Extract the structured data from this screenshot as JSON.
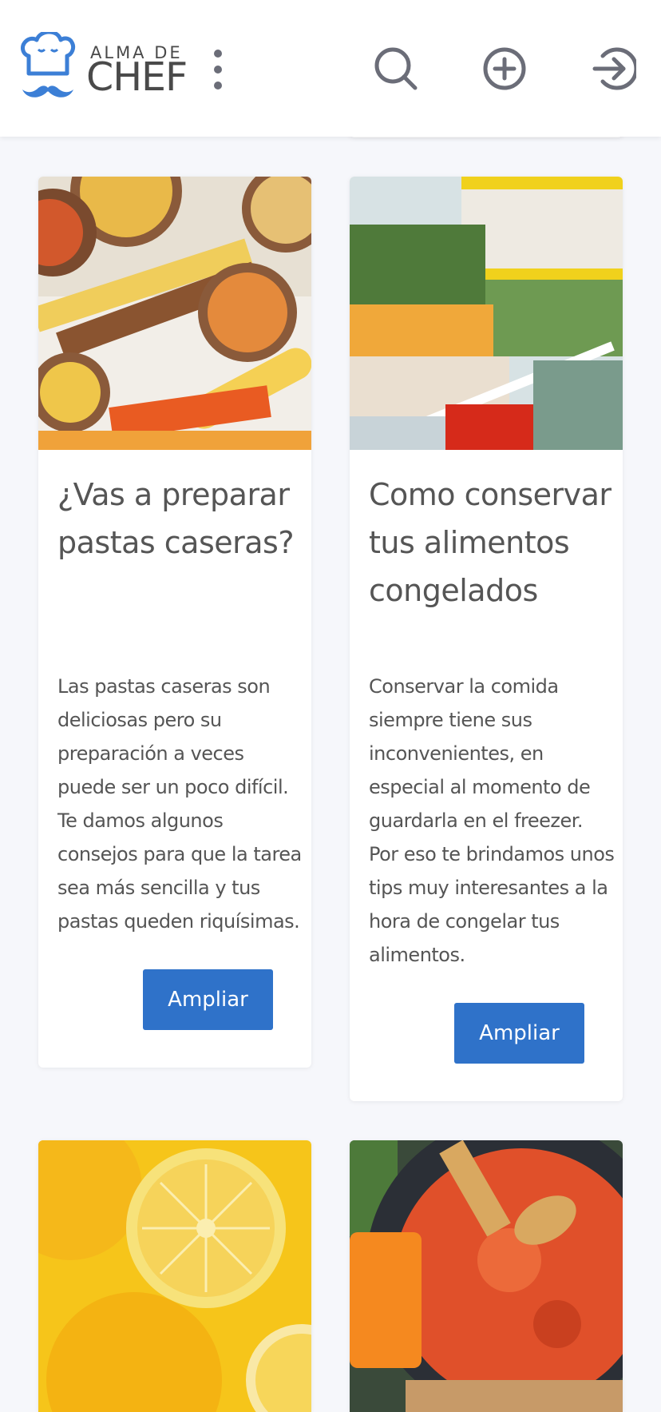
{
  "header": {
    "logo_small": "ALMA DE",
    "logo_big": "CHEF",
    "icons": [
      "chef-hat-logo-icon",
      "more-vertical-icon",
      "search-icon",
      "add-circle-icon",
      "login-icon"
    ]
  },
  "colors": {
    "brand_blue": "#2f72c9",
    "logo_blue": "#3c7fd6",
    "icon_gray": "#6b6d78",
    "text": "#555555",
    "background": "#f6f7fb"
  },
  "cards": [
    {
      "title": "¿Vas a preparar pastas caseras?",
      "text": "Las pastas caseras son deliciosas pero su preparación a veces puede ser un poco difícil. Te damos algunos consejos para que la tarea sea más sencilla y tus pastas queden riquísimas.",
      "button": "Ampliar"
    },
    {
      "title": "Como conservar tus alimentos congelados",
      "text": "Conservar la comida siempre tiene sus inconvenientes, en especial al momento de guardarla en el freezer. Por eso te brindamos unos tips muy interesantes a la hora de congelar tus alimentos.",
      "button": "Ampliar"
    }
  ]
}
